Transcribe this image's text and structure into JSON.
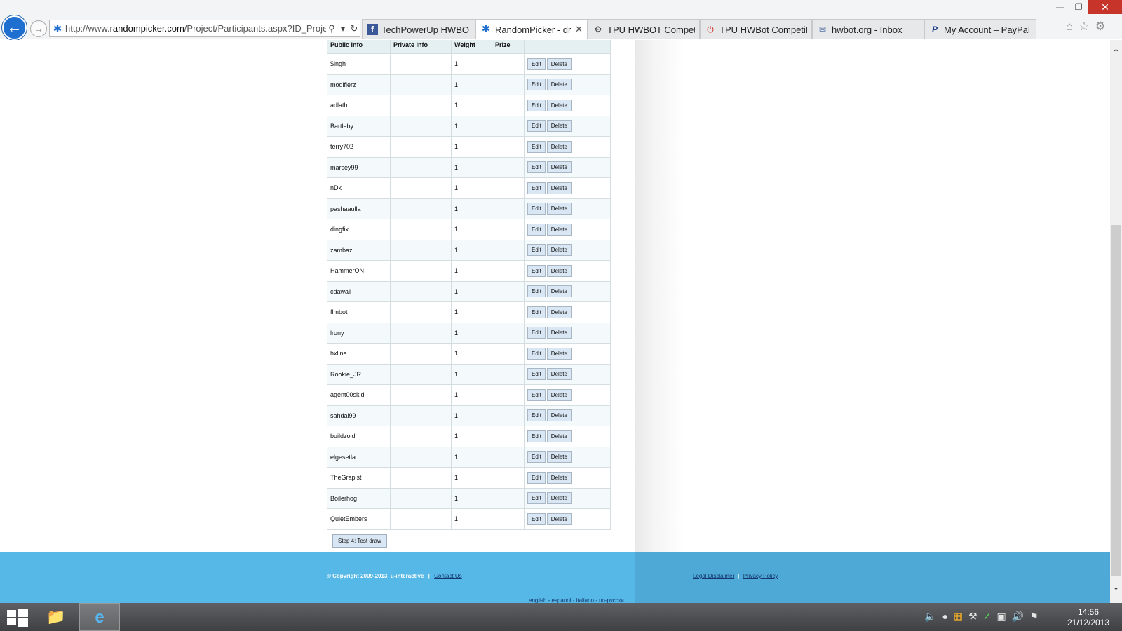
{
  "browser": {
    "url_prefix": "http://www.",
    "url_domain": "randompicker.com",
    "url_path": "/Project/Participants.aspx?ID_Project",
    "tabs": [
      {
        "label": "TechPowerUp HWBOT",
        "icon": "facebook-icon",
        "active": false,
        "closable": false
      },
      {
        "label": "RandomPicker - dra...",
        "icon": "randompicker-icon",
        "active": true,
        "closable": true
      },
      {
        "label": "TPU HWBOT Competiti...",
        "icon": "hwbot-icon",
        "active": false,
        "closable": false
      },
      {
        "label": "TPU HWBot Competiti...",
        "icon": "power-icon",
        "active": false,
        "closable": false
      },
      {
        "label": "hwbot.org - Inbox",
        "icon": "mail-icon",
        "active": false,
        "closable": false
      },
      {
        "label": "My Account – PayPal",
        "icon": "paypal-icon",
        "active": false,
        "closable": false
      }
    ]
  },
  "table": {
    "headers": [
      "Public Info",
      "Private Info",
      "Weight",
      "Prize"
    ],
    "edit_label": "Edit",
    "delete_label": "Delete",
    "rows": [
      {
        "public": "$ingh",
        "private": "",
        "weight": "1",
        "prize": ""
      },
      {
        "public": "modifierz",
        "private": "",
        "weight": "1",
        "prize": ""
      },
      {
        "public": "adlath",
        "private": "",
        "weight": "1",
        "prize": ""
      },
      {
        "public": "Bartleby",
        "private": "",
        "weight": "1",
        "prize": ""
      },
      {
        "public": "terry702",
        "private": "",
        "weight": "1",
        "prize": ""
      },
      {
        "public": "marsey99",
        "private": "",
        "weight": "1",
        "prize": ""
      },
      {
        "public": "nDk",
        "private": "",
        "weight": "1",
        "prize": ""
      },
      {
        "public": "pashaaulla",
        "private": "",
        "weight": "1",
        "prize": ""
      },
      {
        "public": "dingfix",
        "private": "",
        "weight": "1",
        "prize": ""
      },
      {
        "public": "zambaz",
        "private": "",
        "weight": "1",
        "prize": ""
      },
      {
        "public": "HammerON",
        "private": "",
        "weight": "1",
        "prize": ""
      },
      {
        "public": "cdawall",
        "private": "",
        "weight": "1",
        "prize": ""
      },
      {
        "public": "flmbot",
        "private": "",
        "weight": "1",
        "prize": ""
      },
      {
        "public": "lrony",
        "private": "",
        "weight": "1",
        "prize": ""
      },
      {
        "public": "hxline",
        "private": "",
        "weight": "1",
        "prize": ""
      },
      {
        "public": "Rookie_JR",
        "private": "",
        "weight": "1",
        "prize": ""
      },
      {
        "public": "agent00skid",
        "private": "",
        "weight": "1",
        "prize": ""
      },
      {
        "public": "sahdal99",
        "private": "",
        "weight": "1",
        "prize": ""
      },
      {
        "public": "buildzoid",
        "private": "",
        "weight": "1",
        "prize": ""
      },
      {
        "public": "elgesetla",
        "private": "",
        "weight": "1",
        "prize": ""
      },
      {
        "public": "TheGrapist",
        "private": "",
        "weight": "1",
        "prize": ""
      },
      {
        "public": "Boilerhog",
        "private": "",
        "weight": "1",
        "prize": ""
      },
      {
        "public": "QuietEmbers",
        "private": "",
        "weight": "1",
        "prize": ""
      }
    ]
  },
  "step_button": "Step 4: Test draw",
  "footer": {
    "copyright": "© Copyright 2009-2013, u-interactive",
    "separator": "|",
    "contact": "Contact Us",
    "legal": "Legal Disclaimer",
    "privacy": "Privacy Policy",
    "langs": [
      "english",
      "espanol",
      "italiano",
      "по-русски"
    ],
    "lang_separator": " - "
  },
  "taskbar": {
    "time": "14:56",
    "date": "21/12/2013"
  },
  "colors": {
    "footer_blue": "#56b8e6",
    "link_dark_blue": "#15376e",
    "header_bg": "#e4f0f2",
    "button_bg": "#d9e6f3"
  }
}
